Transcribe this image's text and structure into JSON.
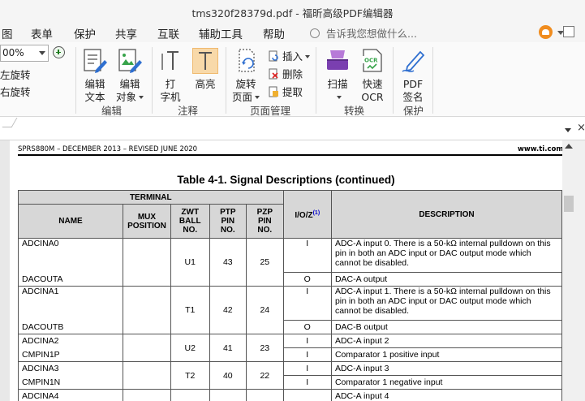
{
  "window": {
    "title": "tms320f28379d.pdf - 福昕高级PDF编辑器"
  },
  "menu": [
    {
      "label": "图"
    },
    {
      "label": "表单"
    },
    {
      "label": "保护"
    },
    {
      "label": "共享"
    },
    {
      "label": "互联"
    },
    {
      "label": "辅助工具"
    },
    {
      "label": "帮助"
    }
  ],
  "tellme": {
    "placeholder": "告诉我您想做什么..."
  },
  "ribbon": {
    "zoom_value": "00%",
    "rotate_left": "左旋转",
    "rotate_right": "右旋转",
    "buttons": {
      "edit_text": [
        "编辑",
        "文本"
      ],
      "edit_object": [
        "编辑",
        "对象"
      ],
      "typewriter": [
        "打",
        "字机"
      ],
      "highlight": "高亮",
      "rotate_page": [
        "旋转",
        "页面"
      ],
      "insert": "插入",
      "delete": "删除",
      "extract": "提取",
      "scan": "扫描",
      "quick_ocr": [
        "快速",
        "OCR"
      ],
      "pdf_sign": [
        "PDF",
        "签名"
      ],
      "ocr_badge": "OCR"
    },
    "groups": {
      "edit": "编辑",
      "annotate": "注释",
      "page_manage": "页面管理",
      "convert": "转换",
      "protect": "保护"
    }
  },
  "document": {
    "header_left": "SPRS880M – DECEMBER 2013 – REVISED JUNE 2020",
    "header_right": "www.ti.com",
    "table_title": "Table 4-1. Signal Descriptions (continued)",
    "headers": {
      "terminal": "TERMINAL",
      "name": "NAME",
      "mux": "MUX POSITION",
      "zwt": "ZWT BALL NO.",
      "ptp": "PTP PIN NO.",
      "pzp": "PZP PIN NO.",
      "ioz": "I/O/Z",
      "ioz_note": "(1)",
      "desc": "DESCRIPTION"
    },
    "rows": [
      {
        "name1": "ADCINA0",
        "name2": "DACOUTA",
        "zwt": "U1",
        "ptp": "43",
        "pzp": "25",
        "io1": "I",
        "io2": "O",
        "desc1": "ADC-A input 0. There is a 50-kΩ internal pulldown on this pin in both an ADC input or DAC output mode which cannot be disabled.",
        "desc2": "DAC-A output"
      },
      {
        "name1": "ADCINA1",
        "name2": "DACOUTB",
        "zwt": "T1",
        "ptp": "42",
        "pzp": "24",
        "io1": "I",
        "io2": "O",
        "desc1": "ADC-A input 1. There is a 50-kΩ internal pulldown on this pin in both an ADC input or DAC output mode which cannot be disabled.",
        "desc2": "DAC-B output"
      },
      {
        "name1": "ADCINA2",
        "name2": "CMPIN1P",
        "zwt": "U2",
        "ptp": "41",
        "pzp": "23",
        "io1": "I",
        "io2": "I",
        "desc1": "ADC-A input 2",
        "desc2": "Comparator 1 positive input"
      },
      {
        "name1": "ADCINA3",
        "name2": "CMPIN1N",
        "zwt": "T2",
        "ptp": "40",
        "pzp": "22",
        "io1": "I",
        "io2": "I",
        "desc1": "ADC-A input 3",
        "desc2": "Comparator 1 negative input"
      },
      {
        "name1": "ADCINA4",
        "desc1": "ADC-A input 4"
      }
    ]
  },
  "colors": {
    "accent": "#f08c1e",
    "header_fill": "#d7d7d7",
    "highlight": "#f8d9a9"
  }
}
